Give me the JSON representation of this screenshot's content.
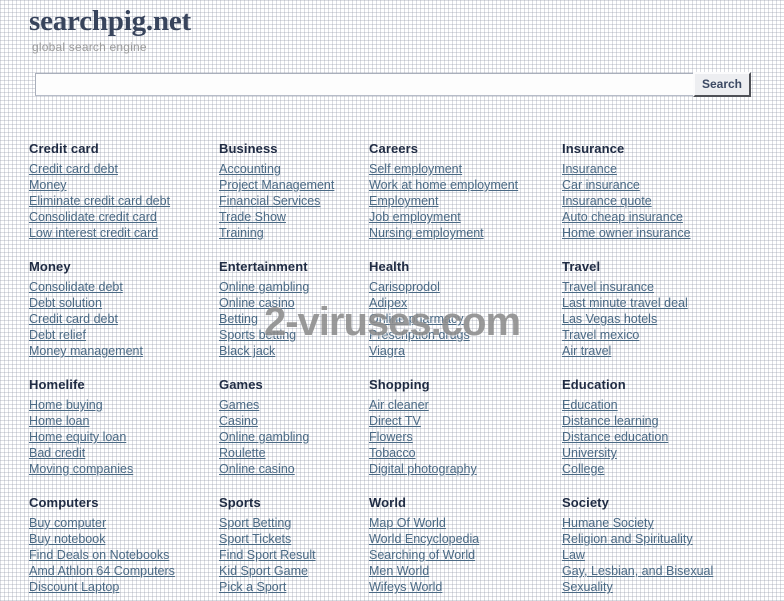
{
  "header": {
    "logo": "searchpig.net",
    "tagline": "global search engine"
  },
  "search": {
    "value": "",
    "placeholder": "",
    "button_label": "Search"
  },
  "watermark": {
    "text": "2-viruses.com"
  },
  "colors": {
    "logo": "#38445c",
    "tagline": "#9b9b9b",
    "category_title": "#1f2b43",
    "link": "#4b6a85",
    "button_text": "#3c4963",
    "watermark": "#8d8d8d",
    "background": "#ffffff"
  },
  "categories": [
    {
      "title": "Credit card",
      "links": [
        "Credit card debt",
        "Money",
        "Eliminate credit card debt",
        "Consolidate credit card",
        "Low interest credit card"
      ]
    },
    {
      "title": "Business",
      "links": [
        "Accounting",
        "Project Management",
        "Financial Services",
        "Trade Show",
        "Training"
      ]
    },
    {
      "title": "Careers",
      "links": [
        "Self employment",
        "Work at home employment",
        "Employment",
        "Job employment",
        "Nursing employment"
      ]
    },
    {
      "title": "Insurance",
      "links": [
        "Insurance",
        "Car insurance",
        "Insurance quote",
        "Auto cheap insurance",
        "Home owner insurance"
      ]
    },
    {
      "title": "Money",
      "links": [
        "Consolidate debt",
        "Debt solution",
        "Credit card debt",
        "Debt relief",
        "Money management"
      ]
    },
    {
      "title": "Entertainment",
      "links": [
        "Online gambling",
        "Online casino",
        "Betting",
        "Sports betting",
        "Black jack"
      ]
    },
    {
      "title": "Health",
      "links": [
        "Carisoprodol",
        "Adipex",
        "Online pharmacy",
        "Prescription drugs",
        "Viagra"
      ]
    },
    {
      "title": "Travel",
      "links": [
        "Travel insurance",
        "Last minute travel deal",
        "Las Vegas hotels",
        "Travel mexico",
        "Air travel"
      ]
    },
    {
      "title": "Homelife",
      "links": [
        "Home buying",
        "Home loan",
        "Home equity loan",
        "Bad credit",
        "Moving companies"
      ]
    },
    {
      "title": "Games",
      "links": [
        "Games",
        "Casino",
        "Online gambling",
        "Roulette",
        "Online casino"
      ]
    },
    {
      "title": "Shopping",
      "links": [
        "Air cleaner",
        "Direct TV",
        "Flowers",
        "Tobacco",
        "Digital photography"
      ]
    },
    {
      "title": "Education",
      "links": [
        "Education",
        "Distance learning",
        "Distance education",
        "University",
        "College"
      ]
    },
    {
      "title": "Computers",
      "links": [
        "Buy computer",
        "Buy notebook",
        "Find Deals on Notebooks",
        "Amd Athlon 64 Computers",
        "Discount Laptop"
      ]
    },
    {
      "title": "Sports",
      "links": [
        "Sport Betting",
        "Sport Tickets",
        "Find Sport Result",
        "Kid Sport Game",
        "Pick a Sport"
      ]
    },
    {
      "title": "World",
      "links": [
        "Map Of World",
        "World Encyclopedia",
        "Searching of World",
        "Men World",
        "Wifeys World"
      ]
    },
    {
      "title": "Society",
      "links": [
        "Humane Society",
        "Religion and Spirituality",
        "Law",
        "Gay, Lesbian, and Bisexual",
        "Sexuality"
      ]
    }
  ]
}
